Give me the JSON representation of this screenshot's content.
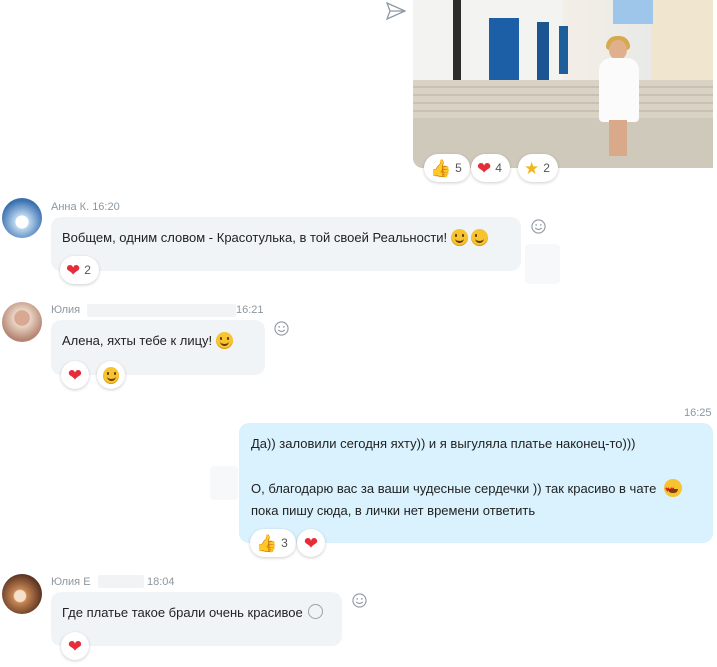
{
  "messages": [
    {
      "id": "photo",
      "reactions": [
        {
          "emoji": "thumbs-up",
          "count": "5"
        },
        {
          "emoji": "heart",
          "count": "4"
        },
        {
          "emoji": "star",
          "count": "2"
        }
      ]
    },
    {
      "id": "anna",
      "author": "Анна К.",
      "time": "16:20",
      "text": "Вобщем, одним словом - Красотулька, в той своей Реальности!",
      "reactions": [
        {
          "emoji": "heart",
          "count": "2"
        }
      ]
    },
    {
      "id": "yulia1",
      "author": "Юлия",
      "time": "16:21",
      "text": "Алена, яхты тебе к лицу!",
      "reactions": [
        {
          "emoji": "heart"
        },
        {
          "emoji": "grinning-face"
        }
      ]
    },
    {
      "id": "me",
      "time": "16:25",
      "line1": "Да)) заловили сегодня яхту)) и я выгуляла платье наконец-то)))",
      "line2": "О, благодарю вас за ваши чудесные сердечки )) так красиво в чате",
      "line3": "пока пишу сюда, в лички нет времени ответить",
      "reactions": [
        {
          "emoji": "thumbs-up",
          "count": "3"
        },
        {
          "emoji": "heart"
        }
      ]
    },
    {
      "id": "yulia2",
      "author": "Юлия Е",
      "time": "18:04",
      "text": "Где платье такое брали очень красивое",
      "reactions": [
        {
          "emoji": "heart"
        }
      ]
    }
  ]
}
